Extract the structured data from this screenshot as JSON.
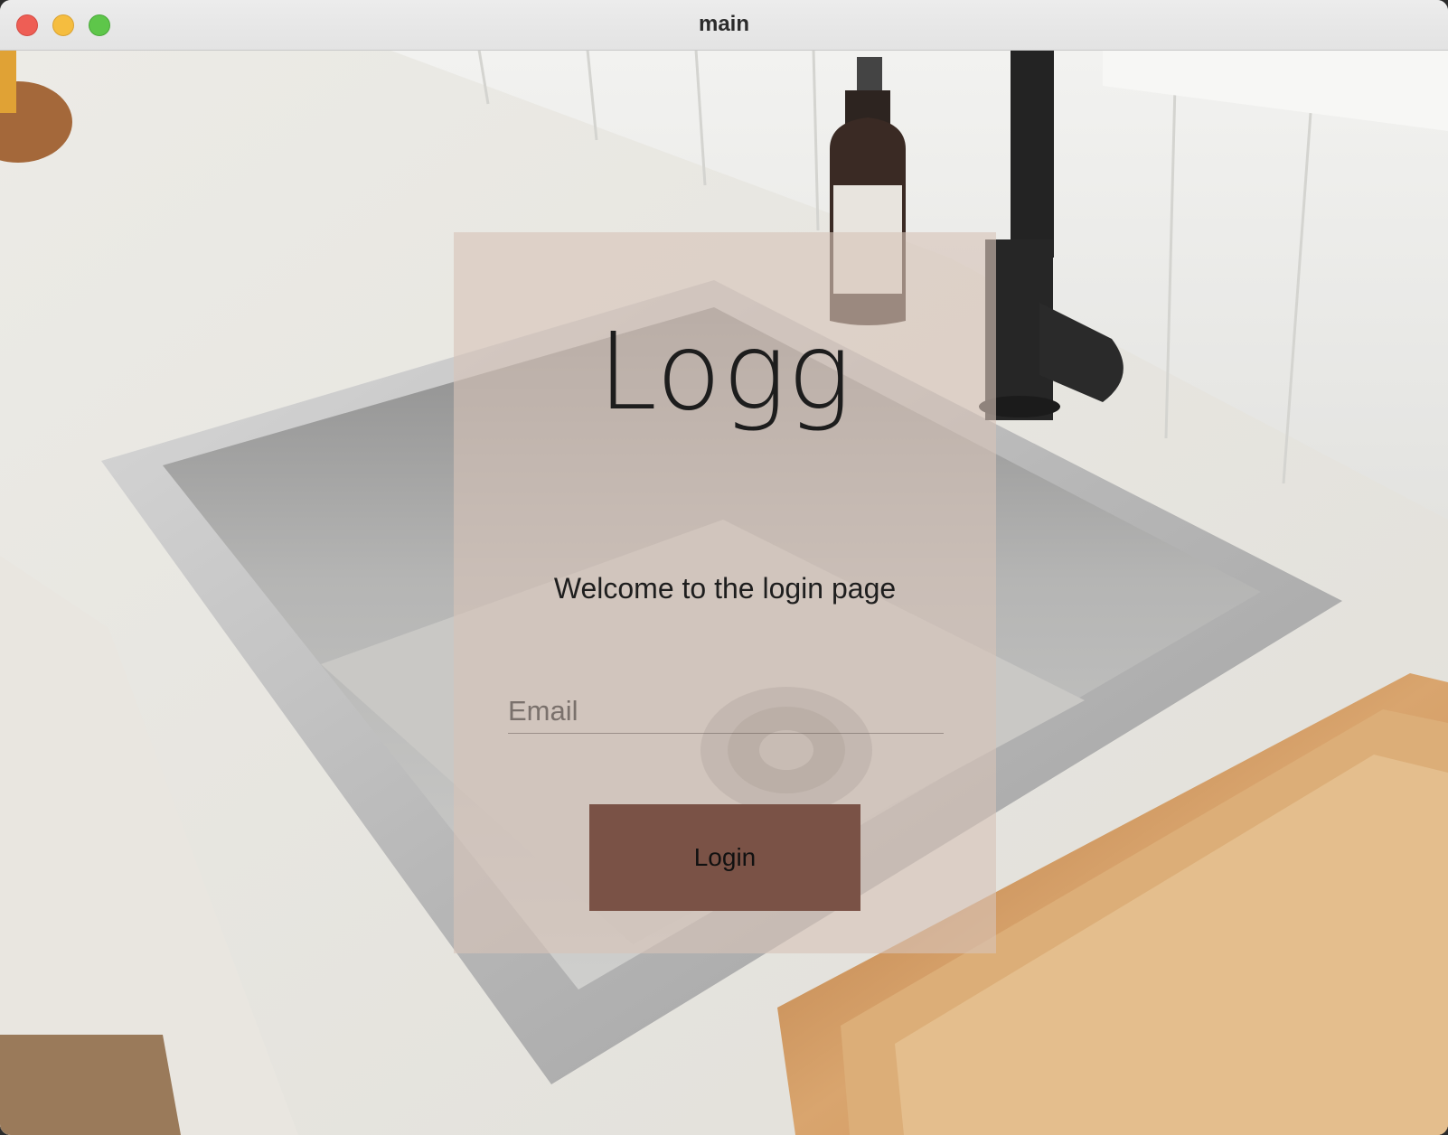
{
  "window": {
    "title": "main"
  },
  "login": {
    "heading": "Logg",
    "welcome": "Welcome to the login page",
    "email_placeholder": "Email",
    "email_value": "",
    "button_label": "Login"
  },
  "colors": {
    "button": "#7a5246",
    "card_overlay": "#d6c4b8"
  },
  "icons": [
    "close-icon",
    "minimize-icon",
    "zoom-icon"
  ]
}
